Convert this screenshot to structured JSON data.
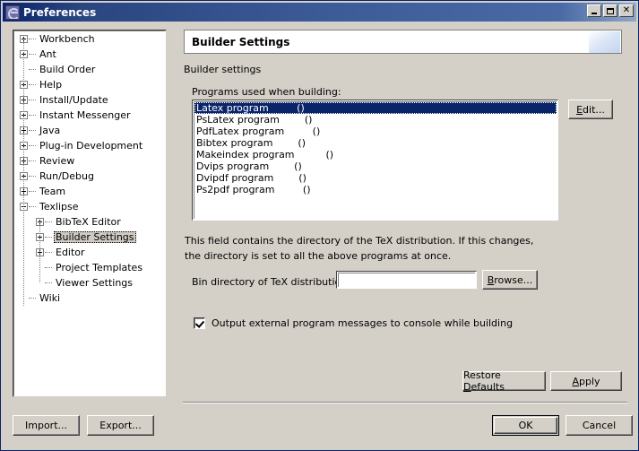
{
  "window": {
    "title": "Preferences",
    "icon": "eclipse-icon",
    "controls": {
      "minimize": "minimize-icon",
      "maximize": "maximize-icon",
      "close": "✕"
    }
  },
  "colors": {
    "titlebar_start": "#0a246a",
    "titlebar_end": "#8fa7c9",
    "face": "#d4d0c8",
    "selection": "#0a246a",
    "tree_selection": "#cfcac3"
  },
  "tree": {
    "items": [
      {
        "label": "Workbench",
        "indent": 0,
        "state": "collapsed"
      },
      {
        "label": "Ant",
        "indent": 0,
        "state": "collapsed"
      },
      {
        "label": "Build Order",
        "indent": 0,
        "state": "leaf"
      },
      {
        "label": "Help",
        "indent": 0,
        "state": "collapsed"
      },
      {
        "label": "Install/Update",
        "indent": 0,
        "state": "collapsed"
      },
      {
        "label": "Instant Messenger",
        "indent": 0,
        "state": "collapsed"
      },
      {
        "label": "Java",
        "indent": 0,
        "state": "collapsed"
      },
      {
        "label": "Plug-in Development",
        "indent": 0,
        "state": "collapsed"
      },
      {
        "label": "Review",
        "indent": 0,
        "state": "collapsed"
      },
      {
        "label": "Run/Debug",
        "indent": 0,
        "state": "collapsed"
      },
      {
        "label": "Team",
        "indent": 0,
        "state": "collapsed"
      },
      {
        "label": "Texlipse",
        "indent": 0,
        "state": "expanded"
      },
      {
        "label": "BibTeX Editor",
        "indent": 1,
        "state": "collapsed"
      },
      {
        "label": "Builder Settings",
        "indent": 1,
        "state": "collapsed",
        "selected": true
      },
      {
        "label": "Editor",
        "indent": 1,
        "state": "collapsed"
      },
      {
        "label": "Project Templates",
        "indent": 1,
        "state": "leaf"
      },
      {
        "label": "Viewer Settings",
        "indent": 1,
        "state": "leaf"
      },
      {
        "label": "Wiki",
        "indent": 0,
        "state": "leaf"
      }
    ]
  },
  "page": {
    "header_title": "Builder Settings",
    "subtitle": "Builder settings",
    "programs_label": "Programs used when building:",
    "programs": [
      {
        "label": "Latex program         ()",
        "selected": true
      },
      {
        "label": "PsLatex program        ()",
        "selected": false
      },
      {
        "label": "PdfLatex program         ()",
        "selected": false
      },
      {
        "label": "Bibtex program        ()",
        "selected": false
      },
      {
        "label": "Makeindex program          ()",
        "selected": false
      },
      {
        "label": "Dvips program        ()",
        "selected": false
      },
      {
        "label": "Dvipdf program        ()",
        "selected": false
      },
      {
        "label": "Ps2pdf program         ()",
        "selected": false
      }
    ],
    "edit_button": "Edit...",
    "edit_button_mnemonic": "E",
    "description_line1": "This field contains the directory of the TeX distribution. If this changes,",
    "description_line2": "the directory is set to all the above programs at once.",
    "bindir_label": "Bin directory of TeX distribution:",
    "bindir_value": "",
    "bindir_placeholder": "",
    "browse_button": "Browse...",
    "browse_button_mnemonic": "B",
    "console_checkbox_label": "Output external program messages to console while building",
    "console_checkbox_checked": true,
    "restore_defaults_button": "Restore Defaults",
    "restore_defaults_pre": "Restore ",
    "restore_defaults_mnemonic": "D",
    "restore_defaults_post": "efaults",
    "apply_button": "Apply",
    "apply_mnemonic": "A",
    "apply_post": "pply"
  },
  "footer": {
    "import_button": "Import...",
    "export_button": "Export...",
    "ok_button": "OK",
    "cancel_button": "Cancel"
  }
}
